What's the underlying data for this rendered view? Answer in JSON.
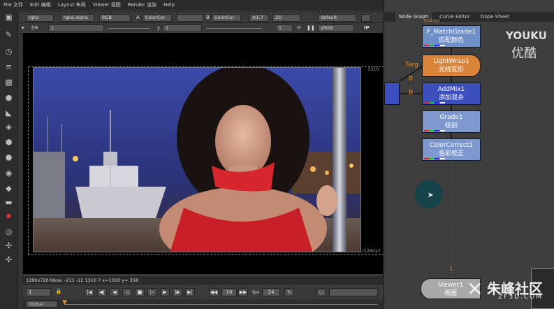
{
  "menu": [
    "File 文件",
    "Edit 编辑",
    "Layout 布局",
    "Viewer 视图",
    "Render 渲染",
    "Help"
  ],
  "viewer_controls": {
    "channels": "rgba",
    "alpha": "rgba.alpha",
    "colorspace": "RGB",
    "a_label": "A",
    "a_input": "ColorCor",
    "dash": "-",
    "b_label": "B",
    "b_input": "ColorCor",
    "wipe": "≡1.7",
    "view_mode": "2D",
    "lut": "default",
    "fstop": "f/8",
    "frame": "1",
    "y_label": "y",
    "y_value": "1",
    "proxy": "1",
    "display": "sRGB",
    "ip": "IP"
  },
  "viewer": {
    "res_top": "1310",
    "res_right": "(1280x7",
    "status": "1280x720  bbox: -211 -12 1310 7  x=1310 y= 358"
  },
  "playback": {
    "frame": "1",
    "step": "10",
    "fps_label": "fps",
    "fps": "24",
    "global": "Global"
  },
  "tabs": [
    "Node Graph",
    "Curve Editor",
    "Dope Sheet"
  ],
  "nodes": [
    {
      "name": "F_MatchGrade1",
      "cn": "匹配颜色"
    },
    {
      "name": "LightWrap1",
      "cn": "光线变形"
    },
    {
      "name": "AddMix1",
      "cn": "添加混合"
    },
    {
      "name": "Grade1",
      "cn": "级别"
    },
    {
      "name": "ColorCorrect1",
      "cn": "色彩校正"
    },
    {
      "name": "Viewer1",
      "cn": "视图"
    }
  ],
  "graph_labels": {
    "colour": "Colour",
    "targ": "Targ",
    "b1": "B",
    "b2": "B",
    "pipe_num": "1"
  },
  "watermark": {
    "youku_en": "YOUKU",
    "youku_cn": "优酷",
    "zf_cn": "朱峰社区",
    "zf_url": "ZF3D.COM"
  },
  "colors": {
    "node_blue": "#6f8fc9",
    "node_orange": "#d9843a",
    "node_dark_blue": "#3d4fbf",
    "node_grey": "#9aa7bd"
  }
}
